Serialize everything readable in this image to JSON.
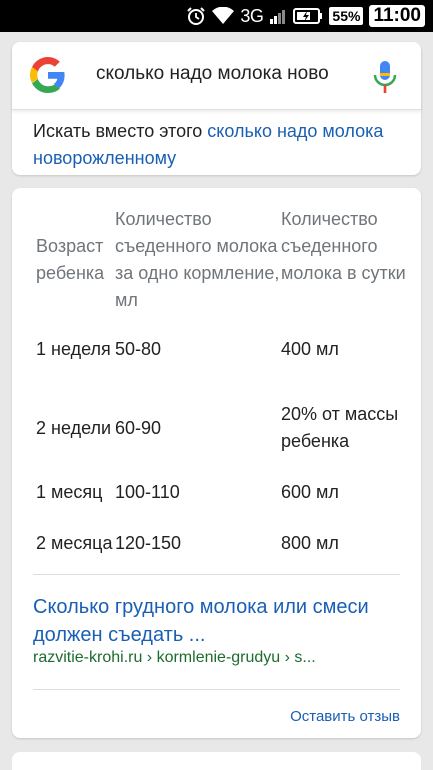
{
  "status_bar": {
    "network": "3G",
    "battery_percent": "55%",
    "time": "11:00",
    "icons": [
      "alarm-icon",
      "wifi-icon",
      "signal-icon",
      "battery-icon"
    ]
  },
  "search": {
    "query": "сколько надо молока ново",
    "suggestion_prefix": "Искать вместо этого",
    "suggestion_link": "сколько надо молока новорожленному"
  },
  "table": {
    "headers": [
      "Возраст ребенка",
      "Количество съеденного молока за одно кормление, мл",
      "Количество съеденного молока в сутки"
    ],
    "rows": [
      [
        "1 неделя",
        "50-80",
        "400 мл"
      ],
      [
        "2 недели",
        "60-90",
        "20% от массы ребенка"
      ],
      [
        "1 месяц",
        "100-110",
        "600 мл"
      ],
      [
        "2 месяца",
        "120-150",
        "800 мл"
      ]
    ]
  },
  "result": {
    "title": "Сколько грудного молока или смеси должен съедать ...",
    "url": "razvitie-krohi.ru › kormlenie-grudyu › s..."
  },
  "feedback_label": "Оставить отзыв",
  "colors": {
    "link": "#1a5fb4",
    "url_green": "#1e6b2e",
    "header_gray": "#70757a",
    "google_blue": "#4285f4",
    "google_red": "#ea4335",
    "google_yellow": "#fbbc05",
    "google_green": "#34a853"
  }
}
